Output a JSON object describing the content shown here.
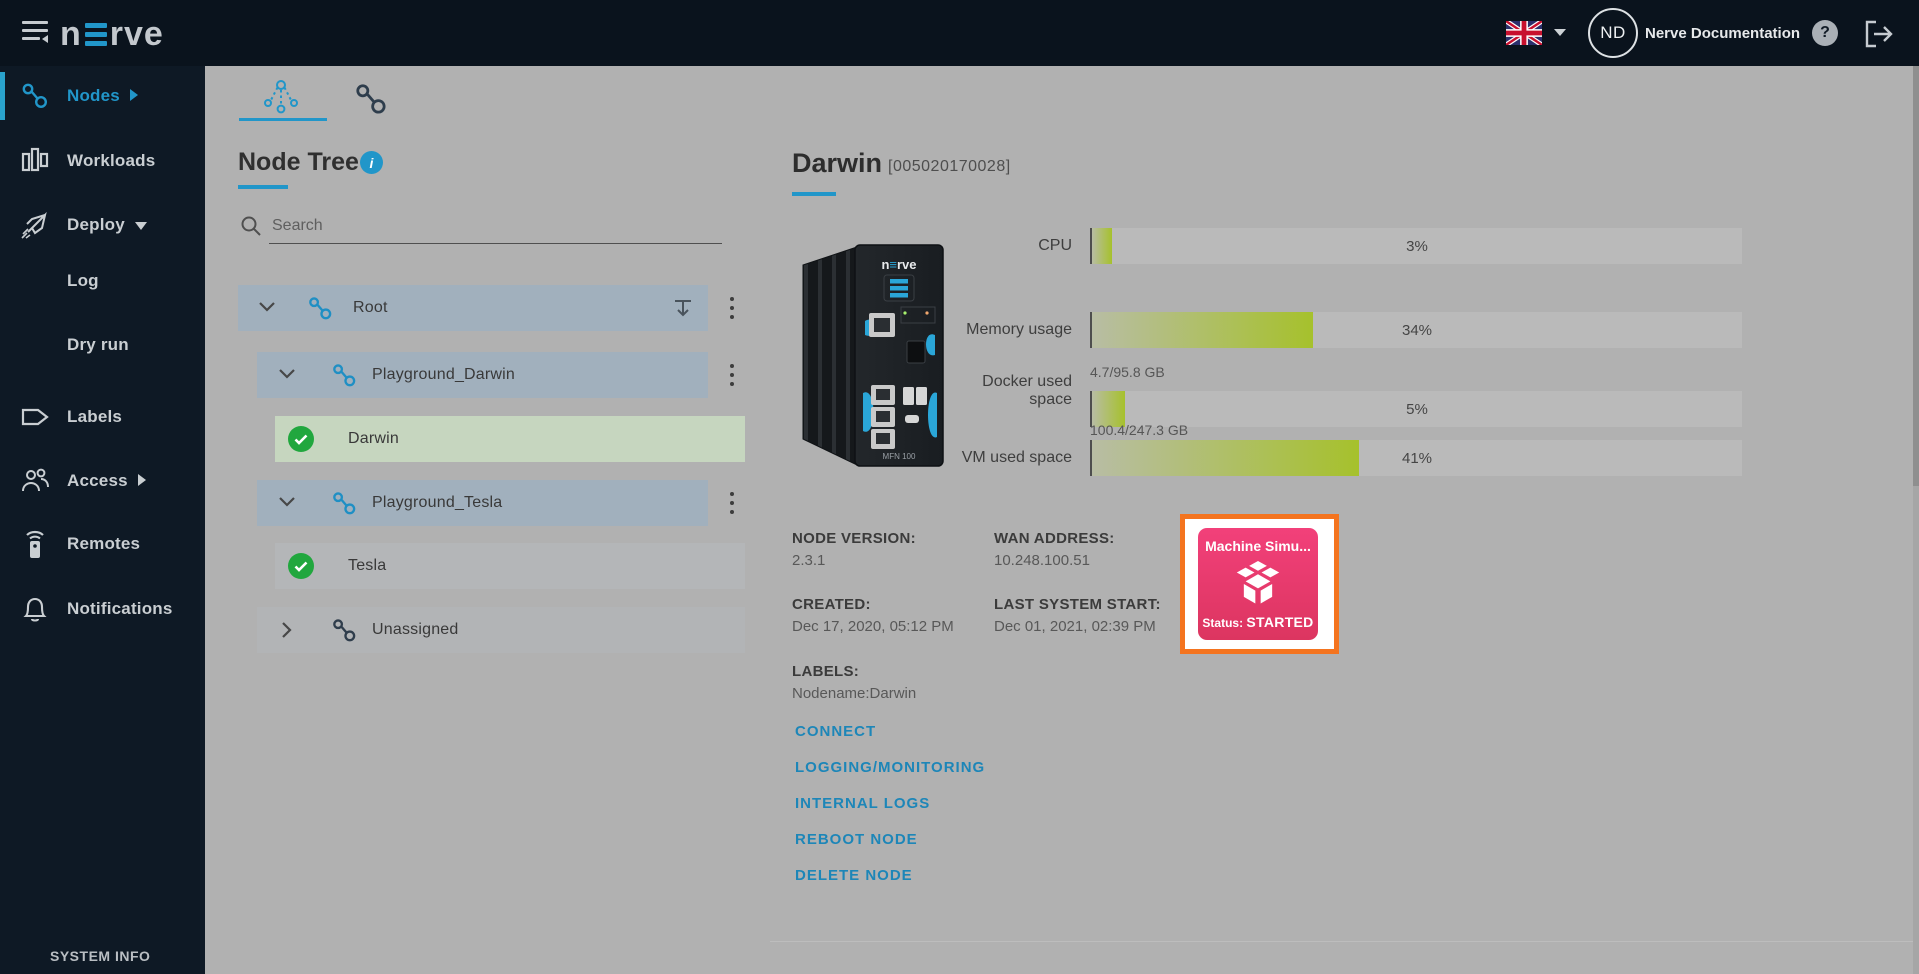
{
  "colors": {
    "accent": "#2196c9",
    "tile_gradient_top": "#f2407a",
    "tile_gradient_bottom": "#dc3560",
    "highlight_orange": "#f4741f",
    "online_green": "#21a73e"
  },
  "topbar": {
    "logo_left": "n",
    "logo_right": "rve",
    "user_initials": "ND",
    "user_name": "Nerve Documentation",
    "help_label": "?"
  },
  "sidebar": {
    "items": [
      {
        "label": "Nodes"
      },
      {
        "label": "Workloads"
      },
      {
        "label": "Deploy"
      },
      {
        "label": "Log"
      },
      {
        "label": "Dry run"
      },
      {
        "label": "Labels"
      },
      {
        "label": "Access"
      },
      {
        "label": "Remotes"
      },
      {
        "label": "Notifications"
      }
    ],
    "footer": "SYSTEM INFO"
  },
  "content": {
    "node_tree": {
      "title": "Node Tree",
      "search_placeholder": "Search",
      "rows": [
        {
          "label": "Root"
        },
        {
          "label": "Playground_Darwin"
        },
        {
          "label": "Darwin"
        },
        {
          "label": "Playground_Tesla"
        },
        {
          "label": "Tesla"
        },
        {
          "label": "Unassigned"
        }
      ]
    },
    "details": {
      "title": "Darwin",
      "serial": "[005020170028]",
      "device_model": "MFN 100",
      "gauges": [
        {
          "label": "CPU",
          "percent": 3,
          "value": "3%"
        },
        {
          "label": "Memory usage",
          "percent": 34,
          "value": "34%"
        },
        {
          "label": "Docker used",
          "label2": "space",
          "sub": "4.7/95.8 GB",
          "percent": 5,
          "value": "5%"
        },
        {
          "label": "VM used space",
          "sub": "100.4/247.3 GB",
          "percent": 41,
          "value": "41%"
        }
      ],
      "fields": [
        {
          "label": "NODE VERSION:",
          "value": "2.3.1"
        },
        {
          "label": "WAN ADDRESS:",
          "value": "10.248.100.51"
        },
        {
          "label": "CREATED:",
          "value": "Dec 17, 2020, 05:12 PM"
        },
        {
          "label": "LAST SYSTEM START:",
          "value": "Dec 01, 2021, 02:39 PM"
        },
        {
          "label": "LABELS:",
          "value": "Nodename:Darwin"
        }
      ],
      "links": [
        "CONNECT",
        "LOGGING/MONITORING",
        "INTERNAL LOGS",
        "REBOOT NODE",
        "DELETE NODE"
      ],
      "workload": {
        "name": "Machine Simu...",
        "status_label": "Status:",
        "status_value": "STARTED"
      }
    }
  }
}
